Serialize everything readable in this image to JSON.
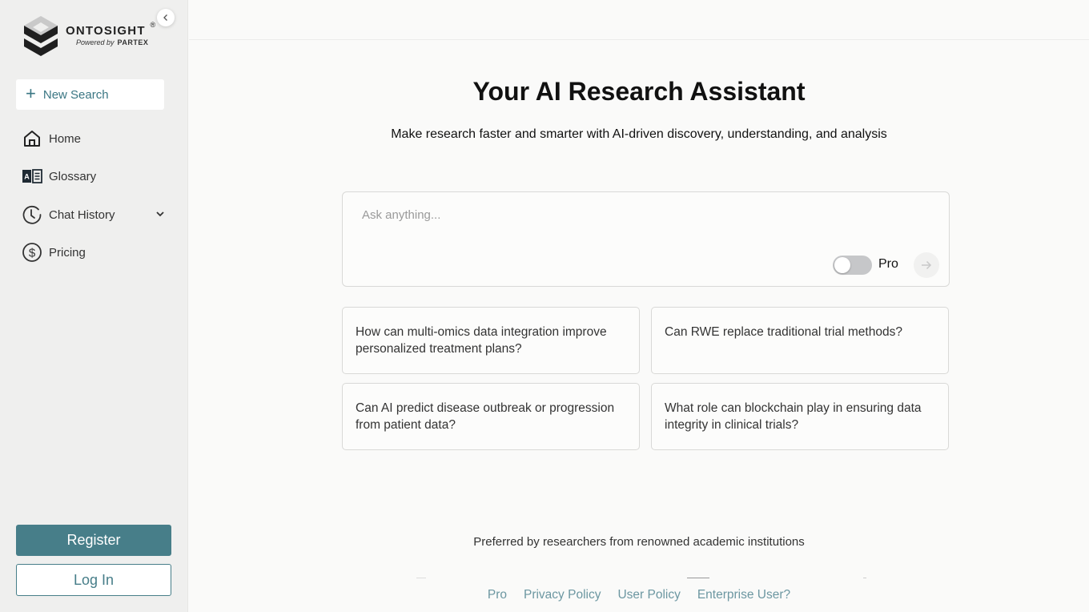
{
  "brand": {
    "name": "ONTOSIGHT",
    "registered": "®",
    "powered_by": "Powered by",
    "partner": "PARTEX"
  },
  "sidebar": {
    "new_search": "New Search",
    "items": [
      {
        "label": "Home",
        "icon": "home-icon"
      },
      {
        "label": "Glossary",
        "icon": "glossary-book-icon"
      },
      {
        "label": "Chat History",
        "icon": "history-clock-icon",
        "expandable": true
      },
      {
        "label": "Pricing",
        "icon": "dollar-circle-icon"
      }
    ],
    "register": "Register",
    "login": "Log In"
  },
  "main": {
    "title": "Your AI Research Assistant",
    "subtitle": "Make research faster and smarter with AI-driven discovery, understanding, and analysis",
    "ask": {
      "placeholder": "Ask anything...",
      "value": "",
      "pro_label": "Pro",
      "pro_enabled": false
    },
    "suggestions": [
      "How can multi-omics data integration improve personalized treatment plans?",
      "Can RWE replace traditional trial methods?",
      "Can AI predict disease outbreak or progression from patient data?",
      "What role can blockchain play in ensuring data integrity in clinical trials?"
    ],
    "preferred_text": "Preferred by researchers from renowned academic institutions"
  },
  "footer": {
    "links": [
      "Pro",
      "Privacy Policy",
      "User Policy",
      "Enterprise User?"
    ]
  },
  "colors": {
    "accent": "#477e89",
    "link": "#6c97a1",
    "sidebar_bg": "#efefee",
    "page_bg": "#fafaf9"
  }
}
